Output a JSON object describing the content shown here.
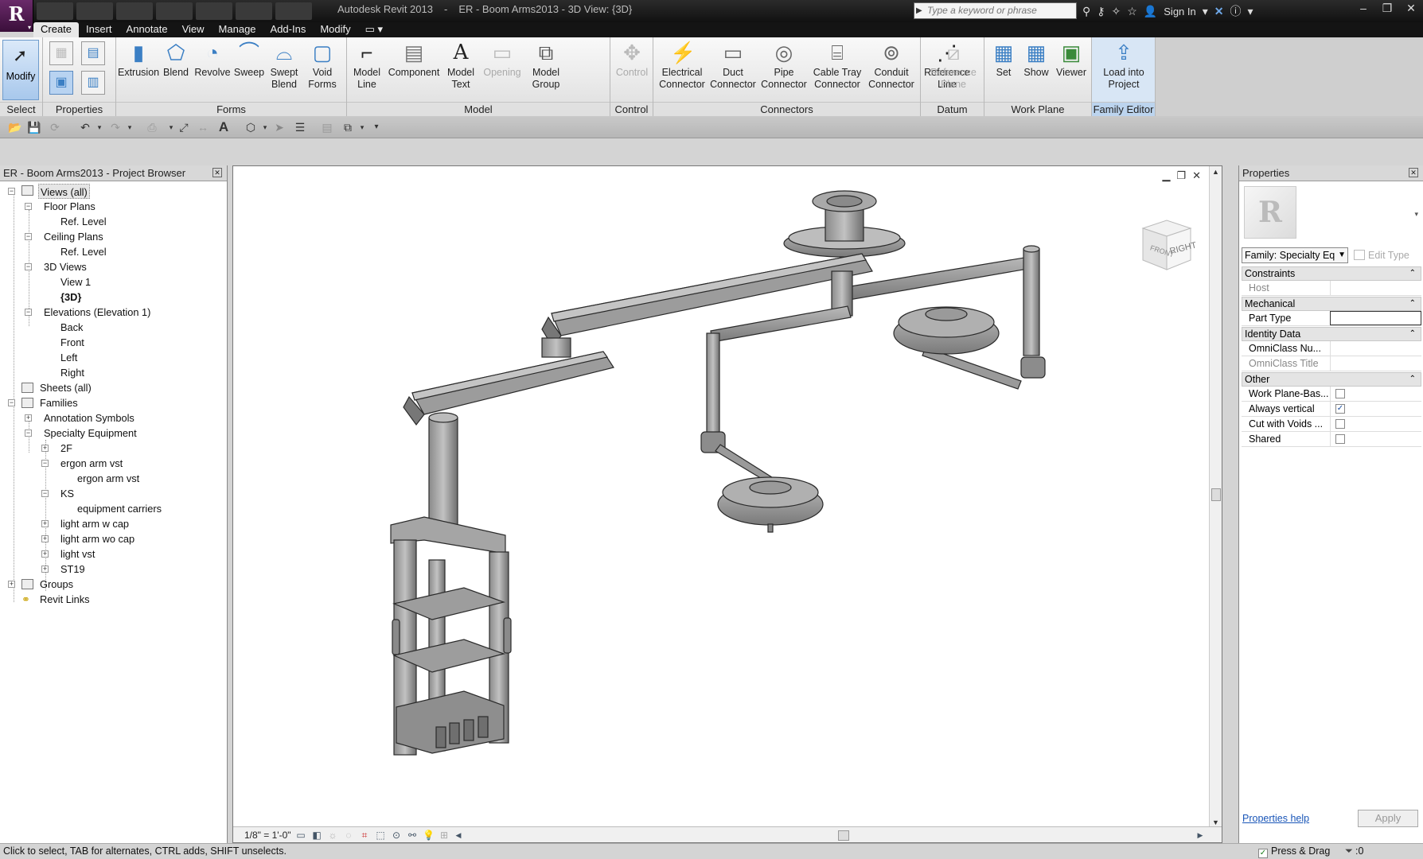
{
  "app": {
    "logo": "R",
    "title_app": "Autodesk Revit 2013",
    "title_sep": "-",
    "title_doc": "ER - Boom Arms2013 - 3D View: {3D}"
  },
  "search": {
    "placeholder": "Type a keyword or phrase"
  },
  "header": {
    "sign_in": "Sign In"
  },
  "tabs": [
    "Create",
    "Insert",
    "Annotate",
    "View",
    "Manage",
    "Add-Ins",
    "Modify"
  ],
  "ribbon": {
    "modify": "Modify",
    "panels": {
      "select": "Select",
      "properties": "Properties",
      "forms": "Forms",
      "model": "Model",
      "control": "Control",
      "connectors": "Connectors",
      "datum": "Datum",
      "work_plane": "Work Plane",
      "family_editor": "Family Editor"
    },
    "forms": [
      "Extrusion",
      "Blend",
      "Revolve",
      "Sweep",
      "Swept\nBlend",
      "Void\nForms"
    ],
    "model": [
      "Model\nLine",
      "Component",
      "Model\nText",
      "Opening",
      "Model\nGroup"
    ],
    "control": "Control",
    "connectors": [
      "Electrical\nConnector",
      "Duct\nConnector",
      "Pipe\nConnector",
      "Cable Tray\nConnector",
      "Conduit\nConnector"
    ],
    "datum": [
      "Reference\nLine",
      "Reference\nPlane"
    ],
    "work_plane": [
      "Set",
      "Show",
      "Viewer"
    ],
    "family_editor": "Load into\nProject"
  },
  "browser": {
    "title": "ER - Boom Arms2013 - Project Browser",
    "nodes": {
      "views_all": "Views (all)",
      "floor_plans": "Floor Plans",
      "fp_ref_level": "Ref. Level",
      "ceiling_plans": "Ceiling Plans",
      "cp_ref_level": "Ref. Level",
      "views_3d": "3D Views",
      "view_1": "View 1",
      "view_3d": "{3D}",
      "elevations": "Elevations (Elevation 1)",
      "back": "Back",
      "front": "Front",
      "left": "Left",
      "right": "Right",
      "sheets": "Sheets (all)",
      "families": "Families",
      "annotation_symbols": "Annotation Symbols",
      "specialty_equipment": "Specialty Equipment",
      "fam_2f": "2F",
      "ergon_arm_vst": "ergon arm vst",
      "ergon_arm_vst_type": "ergon arm vst",
      "ks": "KS",
      "equipment_carriers": "equipment carriers",
      "light_arm_w_cap": "light arm w cap",
      "light_arm_wo_cap": "light arm wo cap",
      "light_vst": "light vst",
      "st19": "ST19",
      "groups": "Groups",
      "revit_links": "Revit Links"
    }
  },
  "viewport": {
    "scale": "1/8\" = 1'-0\"",
    "viewcube_front": "FRONT",
    "viewcube_right": "RIGHT"
  },
  "properties": {
    "title": "Properties",
    "family_selector": "Family: Specialty Eq",
    "edit_type": "Edit Type",
    "groups": {
      "constraints": "Constraints",
      "mechanical": "Mechanical",
      "identity": "Identity Data",
      "other": "Other"
    },
    "rows": {
      "host": "Host",
      "part_type": "Part Type",
      "omniclass_number": "OmniClass Nu...",
      "omniclass_title": "OmniClass Title",
      "work_plane_based": "Work Plane-Bas...",
      "always_vertical": "Always vertical",
      "cut_with_voids": "Cut with Voids ...",
      "shared": "Shared"
    },
    "checkbox_values": {
      "work_plane_based": false,
      "always_vertical": true,
      "cut_with_voids": false,
      "shared": false
    },
    "help": "Properties help",
    "apply": "Apply"
  },
  "status": {
    "hint": "Click to select, TAB for alternates, CTRL adds, SHIFT unselects.",
    "press_drag": "Press & Drag",
    "filter_count": ":0"
  },
  "colors": {
    "accent": "#3b7fc4",
    "titlebar": "#1a1a1a",
    "family_editor_panel": "#d8e6f5"
  }
}
